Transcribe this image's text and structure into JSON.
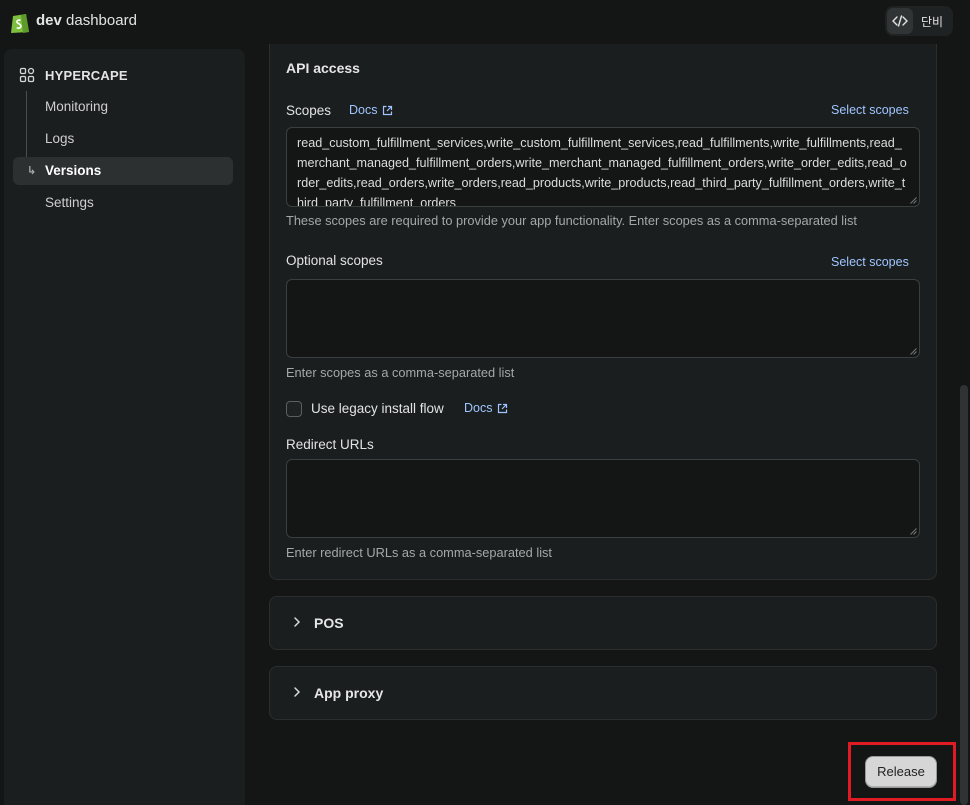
{
  "header": {
    "brand_bold": "dev",
    "brand_rest": " dashboard",
    "user_name": "단비",
    "code_icon": "code-icon",
    "logo_icon": "shopify-bag-icon"
  },
  "sidebar": {
    "app_name": "HYPERCAPE",
    "app_icon": "apps-grid-icon",
    "items": [
      {
        "label": "Monitoring"
      },
      {
        "label": "Logs"
      },
      {
        "label": "Versions",
        "active": true
      },
      {
        "label": "Settings"
      }
    ]
  },
  "api_access": {
    "title": "API access",
    "scopes_label": "Scopes",
    "docs_label": "Docs",
    "select_scopes_label": "Select scopes",
    "scopes_value": "read_custom_fulfillment_services,write_custom_fulfillment_services,read_fulfillments,write_fulfillments,read_merchant_managed_fulfillment_orders,write_merchant_managed_fulfillment_orders,write_order_edits,read_order_edits,read_orders,write_orders,read_products,write_products,read_third_party_fulfillment_orders,write_third_party_fulfillment_orders",
    "scopes_help": "These scopes are required to provide your app functionality. Enter scopes as a comma-separated list",
    "optional_label": "Optional scopes",
    "optional_select_label": "Select scopes",
    "optional_value": "",
    "optional_help": "Enter scopes as a comma-separated list",
    "legacy_label": "Use legacy install flow",
    "legacy_docs_label": "Docs",
    "legacy_checked": false,
    "redirect_label": "Redirect URLs",
    "redirect_value": "",
    "redirect_help": "Enter redirect URLs as a comma-separated list"
  },
  "sections": {
    "pos_title": "POS",
    "proxy_title": "App proxy"
  },
  "footer": {
    "release_label": "Release"
  },
  "colors": {
    "link": "#9ec5ff",
    "highlight": "#e01b24",
    "background": "#141616",
    "card": "#1b1e1e"
  }
}
